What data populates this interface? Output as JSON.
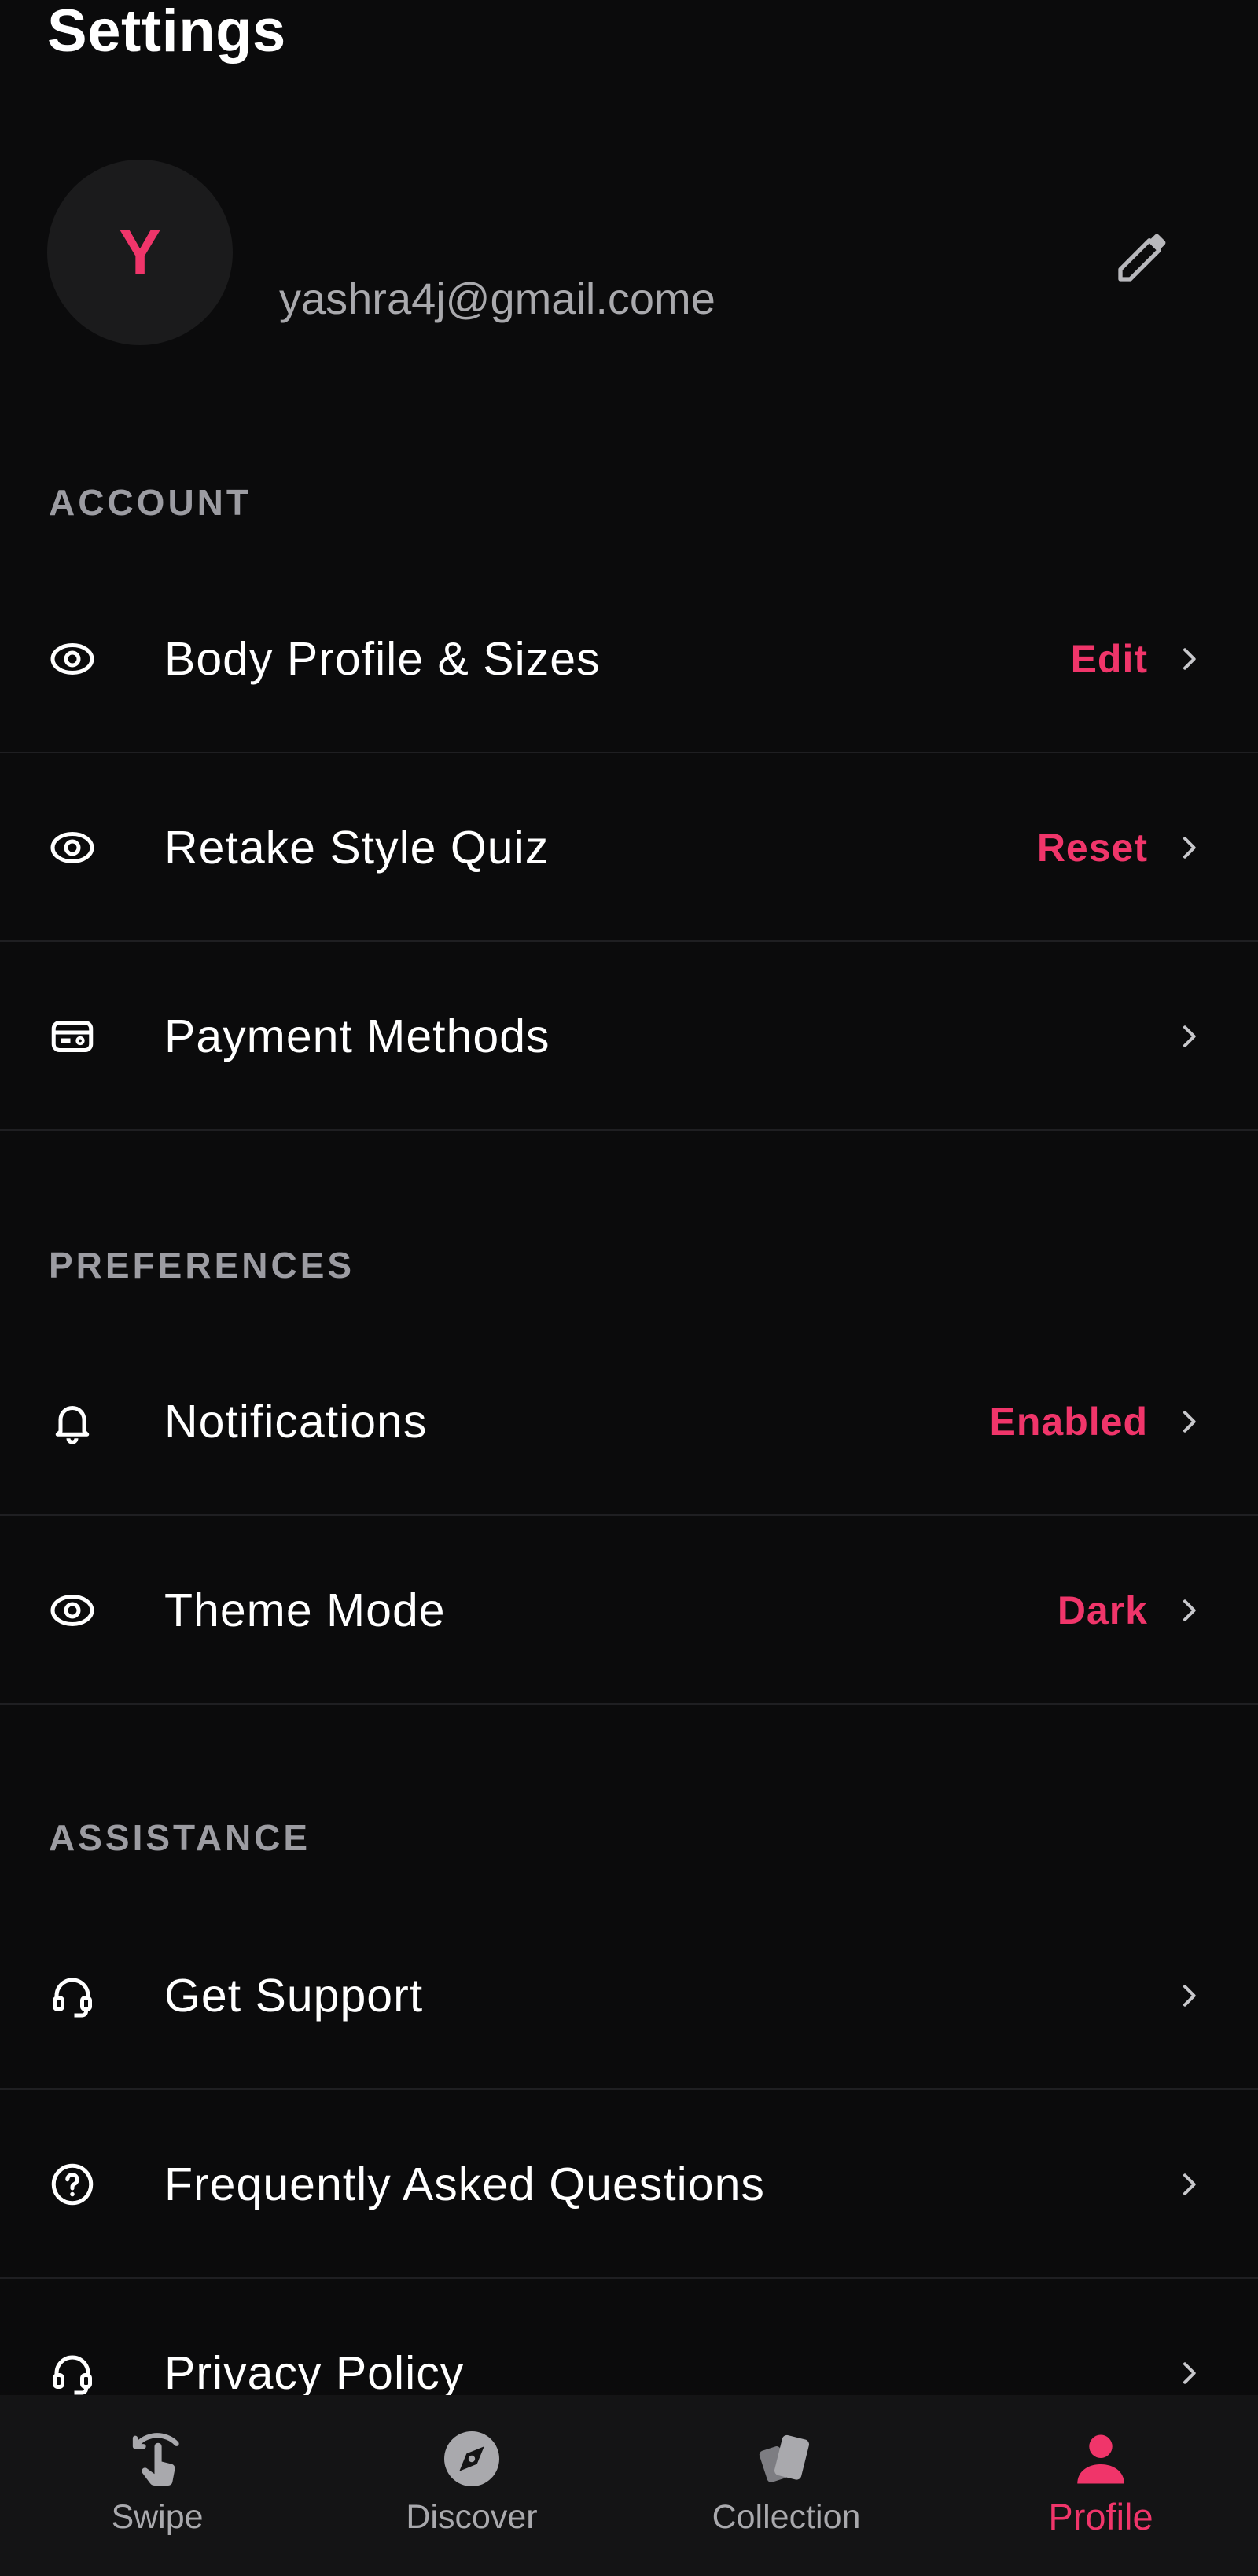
{
  "page": {
    "title": "Settings"
  },
  "profile": {
    "avatar_initial": "Y",
    "email": "yashra4j@gmail.come"
  },
  "colors": {
    "accent": "#f0356a",
    "background": "#0b0b0c",
    "muted_text": "#a9a9ad"
  },
  "sections": {
    "account": {
      "header": "ACCOUNT",
      "items": [
        {
          "label": "Body Profile & Sizes",
          "value": "Edit",
          "icon": "eye-icon"
        },
        {
          "label": "Retake Style Quiz",
          "value": "Reset",
          "icon": "eye-icon"
        },
        {
          "label": "Payment Methods",
          "value": "",
          "icon": "credit-card-icon"
        }
      ]
    },
    "preferences": {
      "header": "PREFERENCES",
      "items": [
        {
          "label": "Notifications",
          "value": "Enabled",
          "icon": "bell-icon"
        },
        {
          "label": "Theme Mode",
          "value": "Dark",
          "icon": "eye-icon"
        }
      ]
    },
    "assistance": {
      "header": "ASSISTANCE",
      "items": [
        {
          "label": "Get Support",
          "value": "",
          "icon": "headset-icon"
        },
        {
          "label": "Frequently Asked Questions",
          "value": "",
          "icon": "question-circle-icon"
        },
        {
          "label": "Privacy Policy",
          "value": "",
          "icon": "headset-icon"
        }
      ]
    }
  },
  "bottom_nav": {
    "items": [
      {
        "label": "Swipe",
        "icon": "swipe-hand-icon",
        "active": false
      },
      {
        "label": "Discover",
        "icon": "compass-icon",
        "active": false
      },
      {
        "label": "Collection",
        "icon": "cards-icon",
        "active": false
      },
      {
        "label": "Profile",
        "icon": "person-icon",
        "active": true
      }
    ]
  }
}
